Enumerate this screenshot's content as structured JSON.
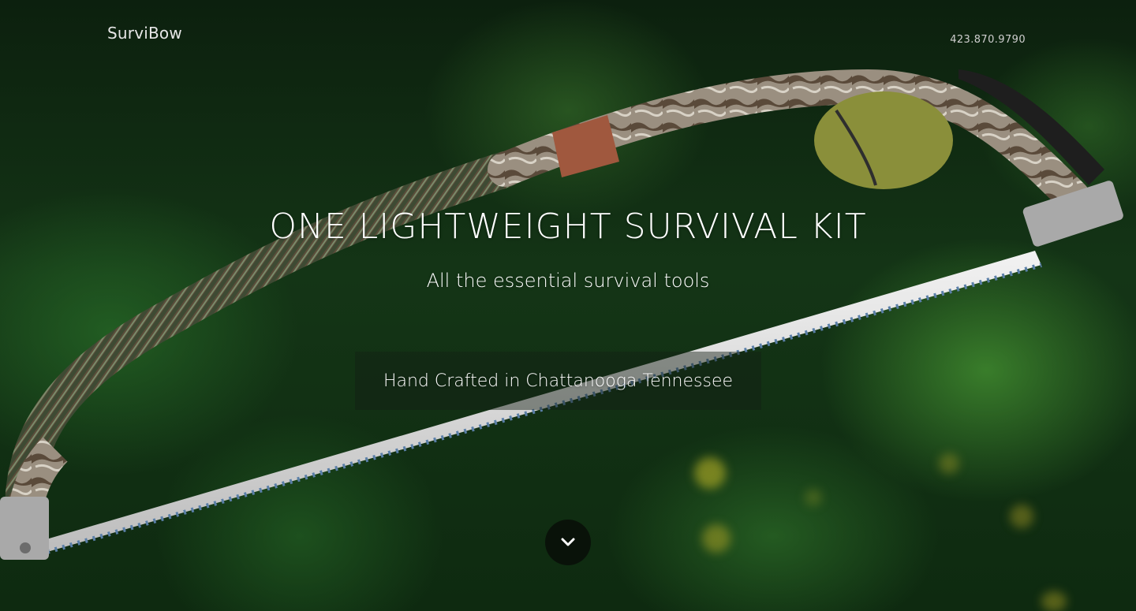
{
  "header": {
    "brand": "SurviBow",
    "phone": "423.870.9790"
  },
  "hero": {
    "headline": "ONE LIGHTWEIGHT SURVIVAL KIT",
    "subheadline": "All the essential survival tools",
    "tagline": "Hand Crafted in Chattanooga Tennessee",
    "scroll_icon": "chevron-down-icon"
  },
  "colors": {
    "text": "#ffffff",
    "foliage": "#1e5a1e",
    "cord": "#4a5a3a",
    "tape": "#a0583e",
    "pouch": "#8a8f3a",
    "blade": "#d8d8d8"
  }
}
